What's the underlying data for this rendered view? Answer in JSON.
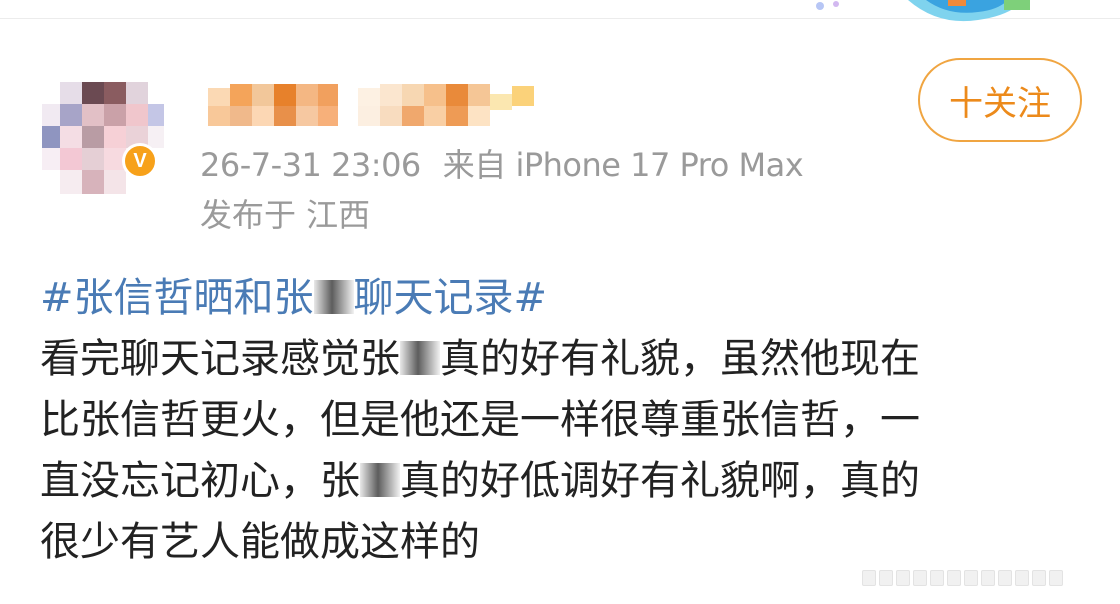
{
  "post": {
    "follow_label": "十关注",
    "timestamp": "26-7-31 23:06",
    "source": "来自 iPhone 17 Pro Max",
    "location": "发布于 江西",
    "hashtag_line": {
      "part1": "#张信哲晒和张",
      "part2": "聊天记录#"
    },
    "body_lines": [
      {
        "before": "看完聊天记录感觉张",
        "after": "真的好有礼貌，虽然他现在"
      },
      {
        "before": "比张信哲更火，但是他还是一样很尊重张信哲，一",
        "after": ""
      },
      {
        "before": "直没忘记初心，张",
        "after": "真的好低调好有礼貌啊，真的"
      },
      {
        "before": "很少有艺人能做成这样的",
        "after": ""
      }
    ]
  },
  "colors": {
    "accent_orange": "#ec8a1b",
    "hashtag_blue": "#4a7bb5",
    "meta_gray": "#9a9a9a",
    "body_text": "#222222"
  },
  "icons": {
    "verified_badge": "orange-v-verified-icon"
  }
}
